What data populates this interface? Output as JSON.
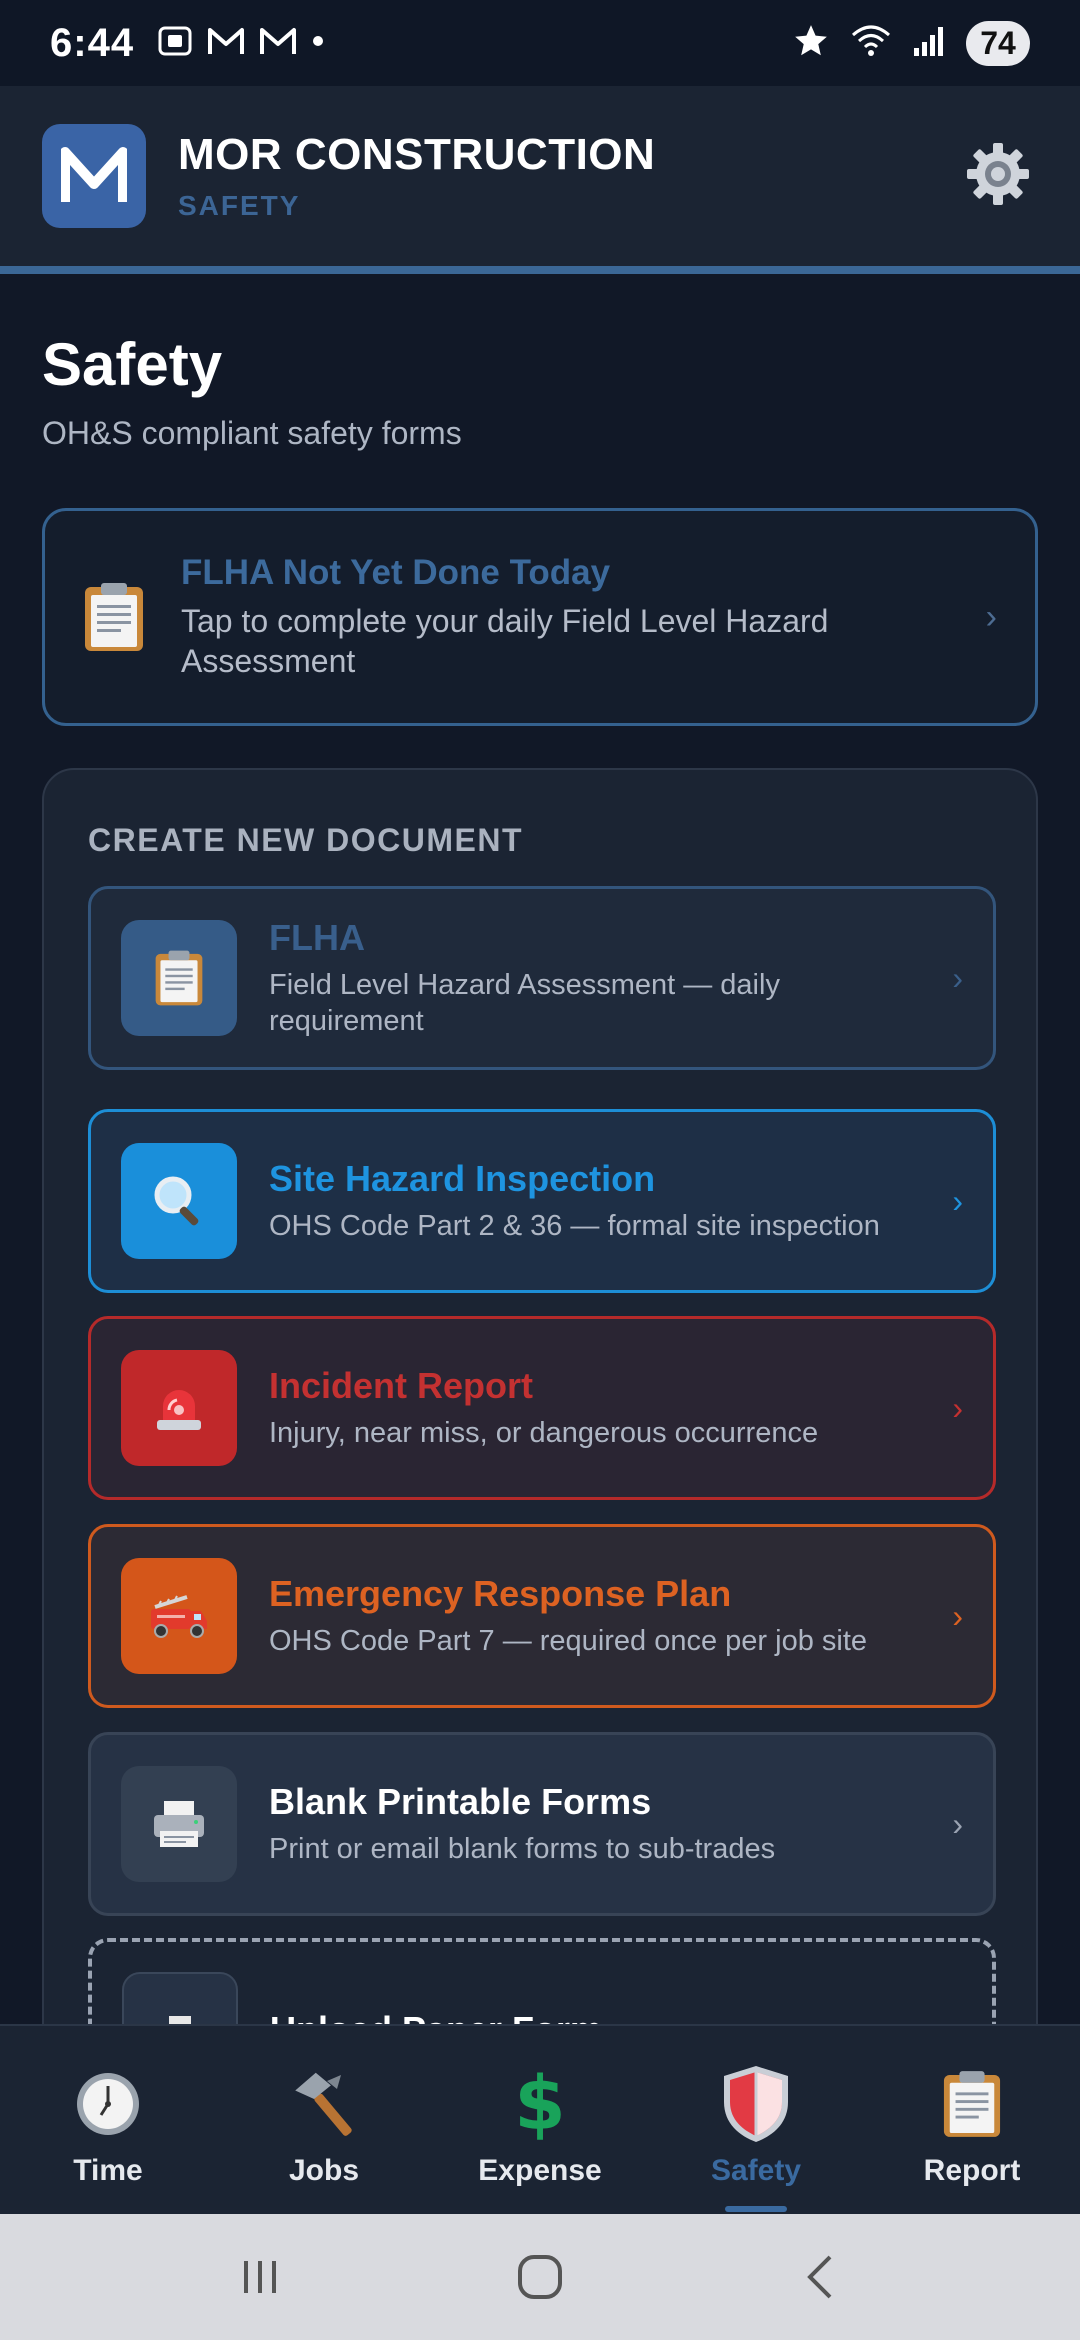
{
  "status_bar": {
    "time": "6:44",
    "battery": "74",
    "left_icons": [
      "screenshot-icon",
      "gmail-icon",
      "gmail-icon",
      "dot-icon"
    ],
    "right_icons": [
      "star-icon",
      "wifi-icon",
      "signal-icon"
    ]
  },
  "header": {
    "title": "MOR CONSTRUCTION",
    "subtitle": "SAFETY",
    "accent": "#3b6796"
  },
  "page": {
    "title": "Safety",
    "subtitle": "OH&S compliant safety forms"
  },
  "alert": {
    "title": "FLHA Not Yet Done Today",
    "description": "Tap to complete your daily Field Level Hazard Assessment",
    "icon": "clipboard-icon"
  },
  "create": {
    "heading": "CREATE NEW DOCUMENT",
    "items": [
      {
        "title": "FLHA",
        "description": "Field Level Hazard Assessment — daily requirement",
        "icon": "clipboard-icon",
        "color": "#395f8c"
      },
      {
        "title": "Site Hazard Inspection",
        "description": "OHS Code Part 2 & 36 — formal site inspection",
        "icon": "magnifier-icon",
        "color": "#1e94e0"
      },
      {
        "title": "Incident Report",
        "description": "Injury, near miss, or dangerous occurrence",
        "icon": "siren-icon",
        "color": "#c43131"
      },
      {
        "title": "Emergency Response Plan",
        "description": "OHS Code Part 7 — required once per job site",
        "icon": "fire-truck-icon",
        "color": "#dd6222"
      },
      {
        "title": "Blank Printable Forms",
        "description": "Print or email blank forms to sub-trades",
        "icon": "printer-icon",
        "color": "#ffffff"
      },
      {
        "title": "Upload Paper Form",
        "description": "",
        "icon": "upload-icon",
        "color": "#ffffff"
      }
    ]
  },
  "nav": {
    "items": [
      {
        "label": "Time",
        "icon": "clock-icon"
      },
      {
        "label": "Jobs",
        "icon": "hammer-icon"
      },
      {
        "label": "Expense",
        "icon": "dollar-icon"
      },
      {
        "label": "Safety",
        "icon": "shield-icon",
        "active": true
      },
      {
        "label": "Report",
        "icon": "clipboard-icon"
      }
    ]
  }
}
